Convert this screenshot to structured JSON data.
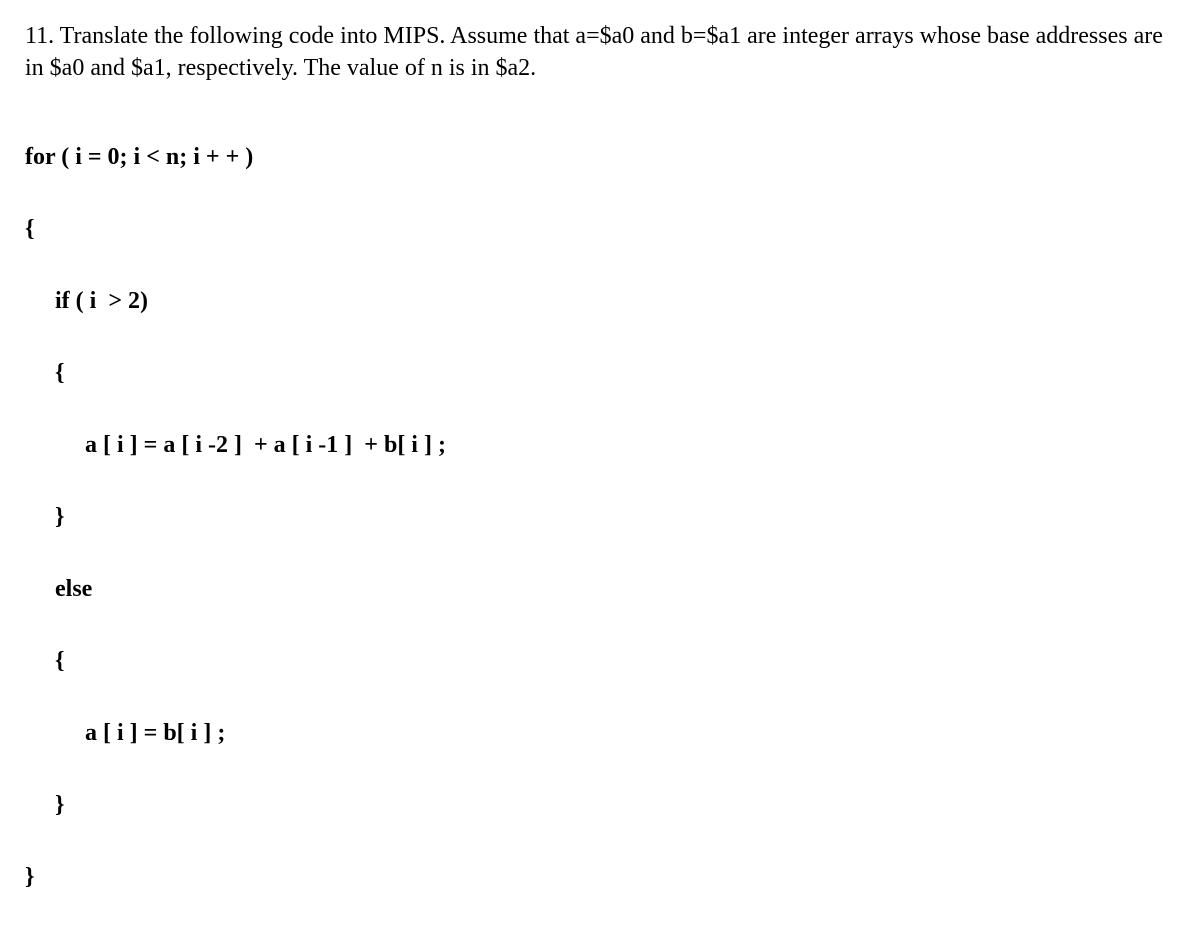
{
  "problem": {
    "text": "11. Translate the following code into MIPS. Assume that a=$a0 and b=$a1 are integer arrays whose base addresses are in $a0 and $a1, respectively. The value of n is in $a2."
  },
  "code": {
    "line1": "for ( i = 0; i < n; i + + )",
    "line2": "{",
    "line3": "if ( i  > 2)",
    "line4": "{",
    "line5": "a [ i ] = a [ i -2 ]  + a [ i -1 ]  + b[ i ] ;",
    "line6": "}",
    "line7": "else",
    "line8": "{",
    "line9": "a [ i ] = b[ i ] ;",
    "line10": "}",
    "line11": "}"
  }
}
